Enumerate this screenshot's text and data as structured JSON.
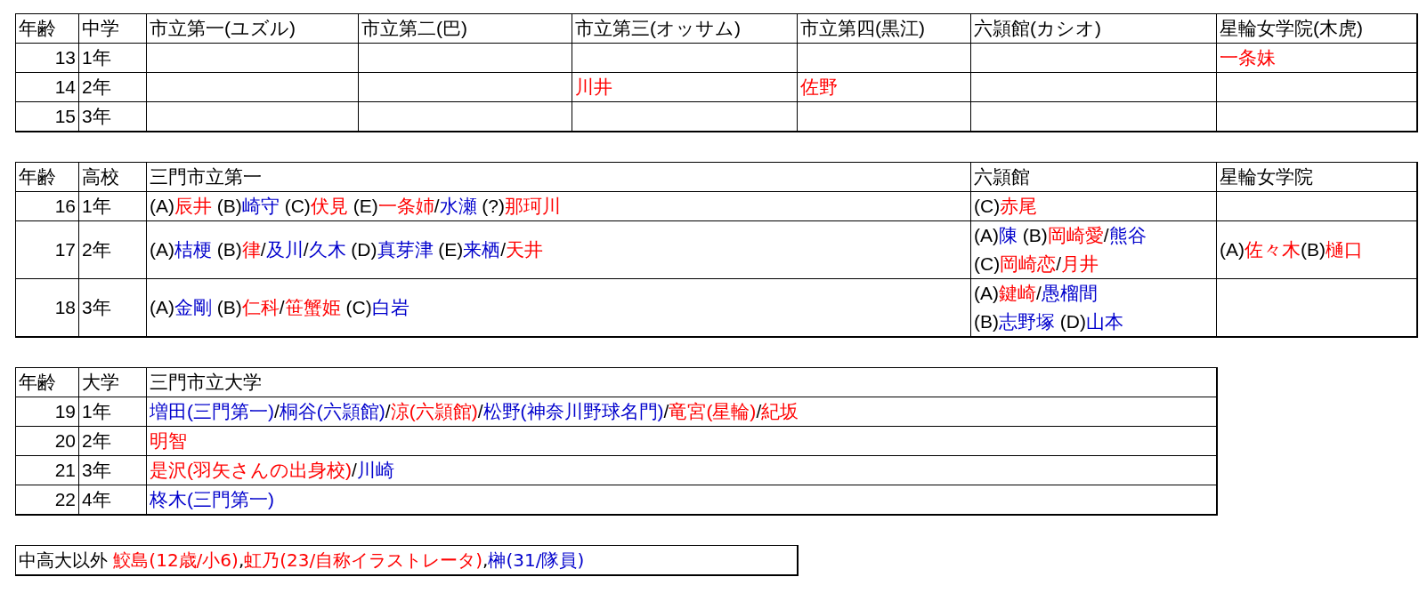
{
  "tables": [
    {
      "columns": [
        "年齢",
        "中学",
        "市立第一(ユズル)",
        "市立第二(巴)",
        "市立第三(オッサム)",
        "市立第四(黒江)",
        "六頴館(カシオ)",
        "星輪女学院(木虎)"
      ],
      "rows": [
        {
          "cells": [
            {
              "lines": [
                [
                  {
                    "text": "13",
                    "color": "#000000"
                  }
                ]
              ]
            },
            {
              "lines": [
                [
                  {
                    "text": "1年",
                    "color": "#000000"
                  }
                ]
              ]
            },
            null,
            null,
            null,
            null,
            null,
            {
              "lines": [
                [
                  {
                    "text": "一条妹",
                    "color": "#ff0000"
                  }
                ]
              ]
            }
          ]
        },
        {
          "cells": [
            {
              "lines": [
                [
                  {
                    "text": "14",
                    "color": "#000000"
                  }
                ]
              ]
            },
            {
              "lines": [
                [
                  {
                    "text": "2年",
                    "color": "#000000"
                  }
                ]
              ]
            },
            null,
            null,
            {
              "lines": [
                [
                  {
                    "text": "川井",
                    "color": "#ff0000"
                  }
                ]
              ]
            },
            {
              "lines": [
                [
                  {
                    "text": "佐野",
                    "color": "#ff0000"
                  }
                ]
              ]
            },
            null,
            null
          ]
        },
        {
          "cells": [
            {
              "lines": [
                [
                  {
                    "text": "15",
                    "color": "#000000"
                  }
                ]
              ]
            },
            {
              "lines": [
                [
                  {
                    "text": "3年",
                    "color": "#000000"
                  }
                ]
              ]
            },
            null,
            null,
            null,
            null,
            null,
            null
          ]
        }
      ]
    },
    {
      "columns": [
        "年齢",
        "高校",
        "三門市立第一",
        "六頴館",
        "星輪女学院"
      ],
      "rows": [
        {
          "cells": [
            {
              "lines": [
                [
                  {
                    "text": "16",
                    "color": "#000000"
                  }
                ]
              ]
            },
            {
              "lines": [
                [
                  {
                    "text": "1年",
                    "color": "#000000"
                  }
                ]
              ]
            },
            {
              "lines": [
                [
                  {
                    "text": "(A)",
                    "color": "#000000"
                  },
                  {
                    "text": "辰井",
                    "color": "#ff0000"
                  },
                  {
                    "text": " (B)",
                    "color": "#000000"
                  },
                  {
                    "text": "崎守",
                    "color": "#0000cc"
                  },
                  {
                    "text": " (C)",
                    "color": "#000000"
                  },
                  {
                    "text": "伏見",
                    "color": "#ff0000"
                  },
                  {
                    "text": " (E)",
                    "color": "#000000"
                  },
                  {
                    "text": "一条姉",
                    "color": "#ff0000"
                  },
                  {
                    "text": "/",
                    "color": "#000000"
                  },
                  {
                    "text": "水瀬",
                    "color": "#0000cc"
                  },
                  {
                    "text": " (?)",
                    "color": "#000000"
                  },
                  {
                    "text": "那珂川",
                    "color": "#ff0000"
                  }
                ]
              ]
            },
            {
              "lines": [
                [
                  {
                    "text": "(C)",
                    "color": "#000000"
                  },
                  {
                    "text": "赤尾",
                    "color": "#ff0000"
                  }
                ]
              ]
            },
            null
          ]
        },
        {
          "cells": [
            {
              "lines": [
                [
                  {
                    "text": "17",
                    "color": "#000000"
                  }
                ]
              ]
            },
            {
              "lines": [
                [
                  {
                    "text": "2年",
                    "color": "#000000"
                  }
                ]
              ]
            },
            {
              "lines": [
                [
                  {
                    "text": "(A)",
                    "color": "#000000"
                  },
                  {
                    "text": "桔梗",
                    "color": "#0000cc"
                  },
                  {
                    "text": " (B)",
                    "color": "#000000"
                  },
                  {
                    "text": "律",
                    "color": "#ff0000"
                  },
                  {
                    "text": "/",
                    "color": "#000000"
                  },
                  {
                    "text": "及川",
                    "color": "#0000cc"
                  },
                  {
                    "text": "/",
                    "color": "#000000"
                  },
                  {
                    "text": "久木",
                    "color": "#0000cc"
                  },
                  {
                    "text": " (D)",
                    "color": "#000000"
                  },
                  {
                    "text": "真芽津",
                    "color": "#0000cc"
                  },
                  {
                    "text": " (E)",
                    "color": "#000000"
                  },
                  {
                    "text": "来栖",
                    "color": "#0000cc"
                  },
                  {
                    "text": "/",
                    "color": "#000000"
                  },
                  {
                    "text": "天井",
                    "color": "#ff0000"
                  }
                ]
              ]
            },
            {
              "lines": [
                [
                  {
                    "text": "(A)",
                    "color": "#000000"
                  },
                  {
                    "text": "陳",
                    "color": "#0000cc"
                  },
                  {
                    "text": " (B)",
                    "color": "#000000"
                  },
                  {
                    "text": "岡崎愛",
                    "color": "#ff0000"
                  },
                  {
                    "text": "/",
                    "color": "#000000"
                  },
                  {
                    "text": "熊谷",
                    "color": "#0000cc"
                  }
                ],
                [
                  {
                    "text": "(C)",
                    "color": "#000000"
                  },
                  {
                    "text": "岡崎恋",
                    "color": "#ff0000"
                  },
                  {
                    "text": "/",
                    "color": "#000000"
                  },
                  {
                    "text": "月井",
                    "color": "#ff0000"
                  }
                ]
              ]
            },
            {
              "lines": [
                [
                  {
                    "text": "(A)",
                    "color": "#000000"
                  },
                  {
                    "text": "佐々木",
                    "color": "#ff0000"
                  },
                  {
                    "text": "(B)",
                    "color": "#000000"
                  },
                  {
                    "text": "樋口",
                    "color": "#ff0000"
                  }
                ]
              ]
            }
          ]
        },
        {
          "cells": [
            {
              "lines": [
                [
                  {
                    "text": "18",
                    "color": "#000000"
                  }
                ]
              ]
            },
            {
              "lines": [
                [
                  {
                    "text": "3年",
                    "color": "#000000"
                  }
                ]
              ]
            },
            {
              "lines": [
                [
                  {
                    "text": "(A)",
                    "color": "#000000"
                  },
                  {
                    "text": "金剛",
                    "color": "#0000cc"
                  },
                  {
                    "text": " (B)",
                    "color": "#000000"
                  },
                  {
                    "text": "仁科",
                    "color": "#ff0000"
                  },
                  {
                    "text": "/",
                    "color": "#000000"
                  },
                  {
                    "text": "笹蟹姫",
                    "color": "#ff0000"
                  },
                  {
                    "text": " (C)",
                    "color": "#000000"
                  },
                  {
                    "text": "白岩",
                    "color": "#0000cc"
                  }
                ]
              ]
            },
            {
              "lines": [
                [
                  {
                    "text": "(A)",
                    "color": "#000000"
                  },
                  {
                    "text": "鍵崎",
                    "color": "#ff0000"
                  },
                  {
                    "text": "/",
                    "color": "#000000"
                  },
                  {
                    "text": "愚榴間",
                    "color": "#0000cc"
                  }
                ],
                [
                  {
                    "text": "(B)",
                    "color": "#000000"
                  },
                  {
                    "text": "志野塚",
                    "color": "#0000cc"
                  },
                  {
                    "text": " (D)",
                    "color": "#000000"
                  },
                  {
                    "text": "山本",
                    "color": "#0000cc"
                  }
                ]
              ]
            },
            null
          ]
        }
      ]
    },
    {
      "columns": [
        "年齢",
        "大学",
        "三門市立大学"
      ],
      "rows": [
        {
          "cells": [
            {
              "lines": [
                [
                  {
                    "text": "19",
                    "color": "#000000"
                  }
                ]
              ]
            },
            {
              "lines": [
                [
                  {
                    "text": "1年",
                    "color": "#000000"
                  }
                ]
              ]
            },
            {
              "lines": [
                [
                  {
                    "text": "増田(三門第一)",
                    "color": "#0000cc"
                  },
                  {
                    "text": "/",
                    "color": "#000000"
                  },
                  {
                    "text": "桐谷(六頴館)",
                    "color": "#0000cc"
                  },
                  {
                    "text": "/",
                    "color": "#000000"
                  },
                  {
                    "text": "涼(六頴館)",
                    "color": "#ff0000"
                  },
                  {
                    "text": "/",
                    "color": "#000000"
                  },
                  {
                    "text": "松野(神奈川野球名門)",
                    "color": "#0000cc"
                  },
                  {
                    "text": "/",
                    "color": "#000000"
                  },
                  {
                    "text": "竜宮(星輪)",
                    "color": "#ff0000"
                  },
                  {
                    "text": "/",
                    "color": "#000000"
                  },
                  {
                    "text": "紀坂",
                    "color": "#ff0000"
                  }
                ]
              ]
            }
          ]
        },
        {
          "cells": [
            {
              "lines": [
                [
                  {
                    "text": "20",
                    "color": "#000000"
                  }
                ]
              ]
            },
            {
              "lines": [
                [
                  {
                    "text": "2年",
                    "color": "#000000"
                  }
                ]
              ]
            },
            {
              "lines": [
                [
                  {
                    "text": "明智",
                    "color": "#ff0000"
                  }
                ]
              ]
            }
          ]
        },
        {
          "cells": [
            {
              "lines": [
                [
                  {
                    "text": "21",
                    "color": "#000000"
                  }
                ]
              ]
            },
            {
              "lines": [
                [
                  {
                    "text": "3年",
                    "color": "#000000"
                  }
                ]
              ]
            },
            {
              "lines": [
                [
                  {
                    "text": "是沢(羽矢さんの出身校)",
                    "color": "#ff0000"
                  },
                  {
                    "text": "/",
                    "color": "#000000"
                  },
                  {
                    "text": "川崎",
                    "color": "#0000cc"
                  }
                ]
              ]
            }
          ]
        },
        {
          "cells": [
            {
              "lines": [
                [
                  {
                    "text": "22",
                    "color": "#000000"
                  }
                ]
              ]
            },
            {
              "lines": [
                [
                  {
                    "text": "4年",
                    "color": "#000000"
                  }
                ]
              ]
            },
            {
              "lines": [
                [
                  {
                    "text": "柊木(三門第一)",
                    "color": "#0000cc"
                  }
                ]
              ]
            }
          ]
        }
      ]
    },
    {
      "rows": [
        {
          "cells": [
            {
              "lines": [
                [
                  {
                    "text": "中高大以外 ",
                    "color": "#000000"
                  },
                  {
                    "text": "鮫島(12歳/小6)",
                    "color": "#ff0000"
                  },
                  {
                    "text": ",",
                    "color": "#000000"
                  },
                  {
                    "text": "虹乃(23/自称イラストレータ)",
                    "color": "#ff0000"
                  },
                  {
                    "text": ",",
                    "color": "#000000"
                  },
                  {
                    "text": "榊(31/隊員)",
                    "color": "#0000cc"
                  }
                ]
              ]
            }
          ]
        }
      ]
    }
  ]
}
